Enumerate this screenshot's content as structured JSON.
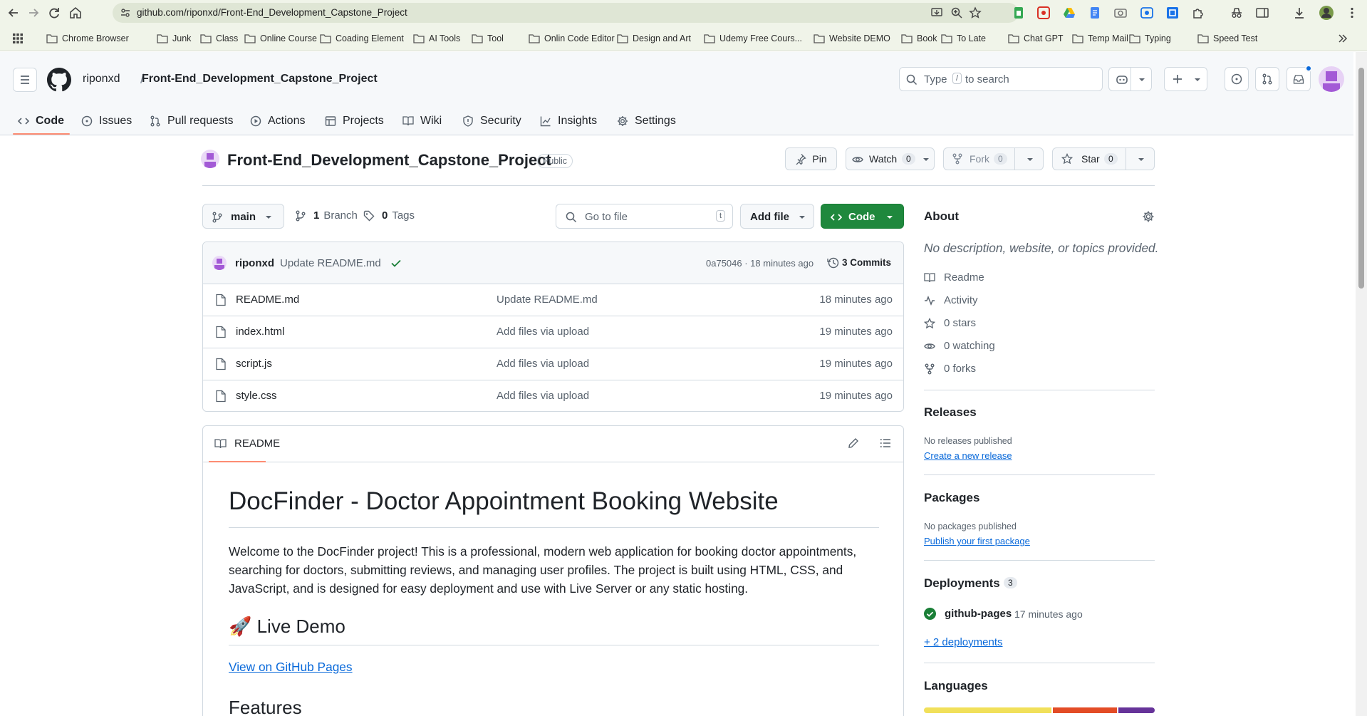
{
  "browser": {
    "url": "github.com/riponxd/Front-End_Development_Capstone_Project",
    "bookmarks": [
      "Chrome Browser",
      "Junk",
      "Class",
      "Online Course",
      "Coading Element",
      "AI Tools",
      "Tool",
      "Onlin Code Editor",
      "Design and Art",
      "Udemy Free Cours...",
      "Website DEMO",
      "Book",
      "To Late",
      "Chat GPT",
      "Temp Mail",
      "Typing",
      "Speed Test"
    ]
  },
  "header": {
    "owner": "riponxd",
    "separator": "/",
    "repo": "Front-End_Development_Capstone_Project",
    "search_placeholder_prefix": "Type",
    "search_key": "/",
    "search_placeholder_suffix": "to search"
  },
  "tabs": [
    "Code",
    "Issues",
    "Pull requests",
    "Actions",
    "Projects",
    "Wiki",
    "Security",
    "Insights",
    "Settings"
  ],
  "repo": {
    "name": "Front-End_Development_Capstone_Project",
    "visibility": "Public",
    "pin_label": "Pin",
    "watch_label": "Watch",
    "watch_count": "0",
    "fork_label": "Fork",
    "fork_count": "0",
    "star_label": "Star",
    "star_count": "0"
  },
  "toolbar": {
    "branch": "main",
    "branches_count": "1",
    "branches_label": "Branch",
    "tags_count": "0",
    "tags_label": "Tags",
    "goto_placeholder": "Go to file",
    "goto_key": "t",
    "add_file_label": "Add file",
    "code_label": "Code"
  },
  "commit": {
    "author": "riponxd",
    "message": "Update README.md",
    "hash_time": "0a75046 · 18 minutes ago",
    "commits_label": "3 Commits"
  },
  "files": [
    {
      "name": "README.md",
      "message": "Update README.md",
      "time": "18 minutes ago"
    },
    {
      "name": "index.html",
      "message": "Add files via upload",
      "time": "19 minutes ago"
    },
    {
      "name": "script.js",
      "message": "Add files via upload",
      "time": "19 minutes ago"
    },
    {
      "name": "style.css",
      "message": "Add files via upload",
      "time": "19 minutes ago"
    }
  ],
  "readme": {
    "tab_label": "README",
    "title": "DocFinder - Doctor Appointment Booking Website",
    "intro": "Welcome to the DocFinder project! This is a professional, modern web application for booking doctor appointments, searching for doctors, submitting reviews, and managing user profiles. The project is built using HTML, CSS, and JavaScript, and is designed for easy deployment and use with Live Server or any static hosting.",
    "live_demo_heading": "🚀 Live Demo",
    "live_demo_link": "View on GitHub Pages",
    "features_heading": "Features"
  },
  "about": {
    "heading": "About",
    "description": "No description, website, or topics provided.",
    "items": [
      "Readme",
      "Activity",
      "0 stars",
      "0 watching",
      "0 forks"
    ],
    "releases_heading": "Releases",
    "releases_none": "No releases published",
    "releases_link": "Create a new release",
    "packages_heading": "Packages",
    "packages_none": "No packages published",
    "packages_link": "Publish your first package",
    "deployments_heading": "Deployments",
    "deployments_count": "3",
    "deployment_name": "github-pages",
    "deployment_time": "17 minutes ago",
    "more_deployments": "+ 2 deployments",
    "languages_heading": "Languages",
    "languages_shares": [
      0.56,
      0.28,
      0.16
    ],
    "languages_colors": [
      "#f1e05a",
      "#e34c26",
      "#663399"
    ]
  },
  "colors": {
    "accent_green": "#1f883d",
    "link_blue": "#0969da",
    "tab_underline": "#fd8c73"
  }
}
